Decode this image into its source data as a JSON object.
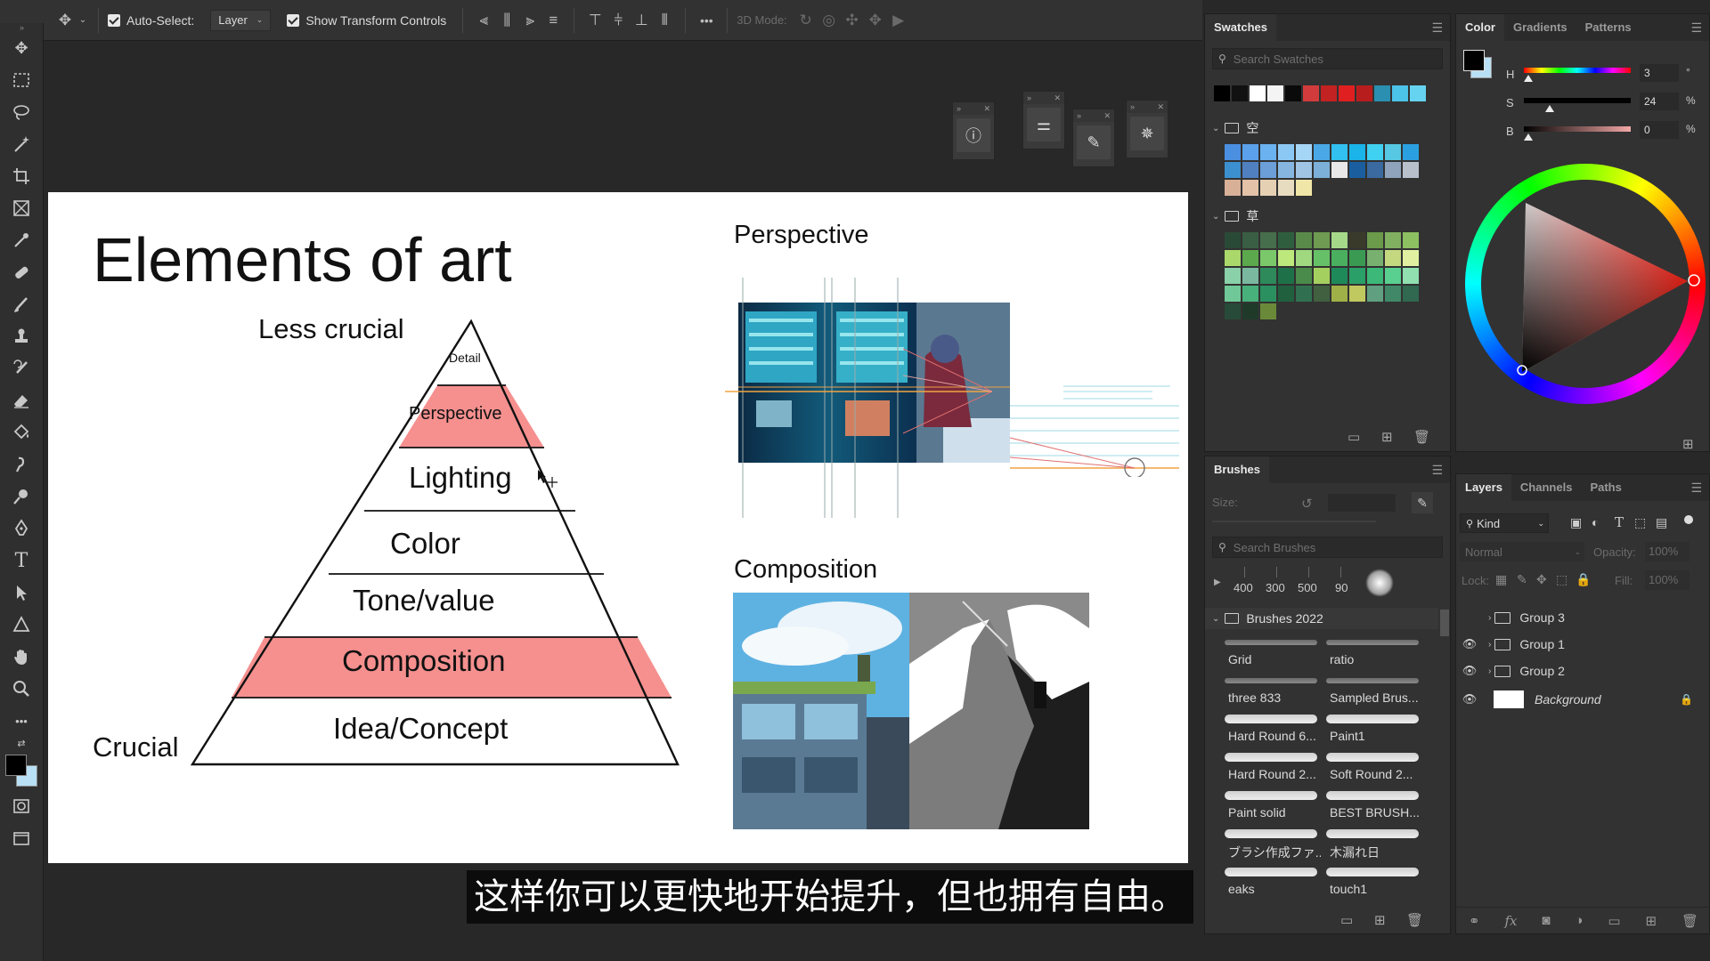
{
  "options_bar": {
    "auto_select_label": "Auto-Select:",
    "layer_dropdown": "Layer",
    "transform_label": "Show Transform Controls",
    "more_label": "•••",
    "mode_3d_label": "3D Mode:"
  },
  "slide": {
    "title": "Elements of art",
    "less_crucial": "Less crucial",
    "crucial": "Crucial",
    "levels": [
      "Detail",
      "Perspective",
      "Lighting",
      "Color",
      "Tone/value",
      "Composition",
      "Idea/Concept"
    ],
    "perspective_title": "Perspective",
    "composition_title": "Composition",
    "highlight_color": "#f5908f"
  },
  "subtitle": "这样你可以更快地开始提升，但也拥有自由。",
  "swatches": {
    "tab": "Swatches",
    "search_placeholder": "Search Swatches",
    "folder1": "空",
    "folder2": "草",
    "top_colors": [
      "#000000",
      "#111111",
      "#ffffff",
      "#f4f4f4",
      "#0a0a0a",
      "#d23b3b",
      "#c32222",
      "#e02020",
      "#b81d1d",
      "#2a8fb0",
      "#4cc3e8",
      "#66d4f0"
    ],
    "sky_colors": [
      "#4a8fe0",
      "#5aa0ea",
      "#6ab2f0",
      "#8cc8f4",
      "#a6d6f6",
      "#4aa8e6",
      "#32c0f0",
      "#1ab4e8",
      "#40d0f0",
      "#56c8e4",
      "#2aa0e0",
      "#3c90d0",
      "#5080c0",
      "#6c9ed8",
      "#86b6e0",
      "#a0c4e4",
      "#7cb0d8",
      "#e8e8e8",
      "#1a5ea0",
      "#3a6aa0",
      "#8fa4bc",
      "#b8c0cc",
      "#d8b098",
      "#e4c2a8",
      "#e6d0b4",
      "#e8dcc0",
      "#f0e6a8"
    ],
    "grass_colors": [
      "#2a4a38",
      "#3a5e44",
      "#466e4c",
      "#2e5e3e",
      "#5a8a4a",
      "#6e9a52",
      "#a6d88a",
      "#3a3a2a",
      "#6a9a4a",
      "#80b060",
      "#8cc060",
      "#aad86a",
      "#5ca84c",
      "#7ac86a",
      "#bce87c",
      "#a0d880",
      "#66c068",
      "#4ab060",
      "#3a9a52",
      "#78b070",
      "#c4d880",
      "#e0f0a0",
      "#8ad0a8",
      "#7ab8a0",
      "#2e8a5a",
      "#1e7048",
      "#4a8a4a",
      "#a4d060",
      "#1e8a5a",
      "#2aa068",
      "#3cb878",
      "#5ad090",
      "#90e0b0",
      "#70c898",
      "#48b07a",
      "#2a9060",
      "#20603e",
      "#307050",
      "#406040",
      "#a0b048",
      "#c0c860",
      "#60a080",
      "#408868",
      "#306850",
      "#284a38",
      "#203a2a",
      "#6a8a3a"
    ]
  },
  "color_panel": {
    "tabs": [
      "Color",
      "Gradients",
      "Patterns"
    ],
    "h_label": "H",
    "h_value": "3",
    "h_unit": "°",
    "s_label": "S",
    "s_value": "24",
    "s_unit": "%",
    "b_label": "B",
    "b_value": "0",
    "b_unit": "%"
  },
  "brushes": {
    "tab": "Brushes",
    "size_label": "Size:",
    "search_placeholder": "Search Brushes",
    "presets": [
      "400",
      "300",
      "500",
      "90"
    ],
    "folder": "Brushes 2022",
    "items": [
      "Grid",
      "ratio",
      "three 833",
      "Sampled Brus...",
      "Hard Round 6...",
      "Paint1",
      "Hard Round 2...",
      "Soft Round 2...",
      "Paint solid",
      "BEST BRUSH...",
      "ブラシ作成ファ...",
      "木漏れ日",
      "eaks",
      "touch1"
    ]
  },
  "layers": {
    "tabs": [
      "Layers",
      "Channels",
      "Paths"
    ],
    "kind_label": "Kind",
    "blend_mode": "Normal",
    "opacity_label": "Opacity:",
    "opacity_value": "100%",
    "lock_label": "Lock:",
    "fill_label": "Fill:",
    "fill_value": "100%",
    "items": [
      "Group 3",
      "Group 1",
      "Group 2",
      "Background"
    ]
  }
}
